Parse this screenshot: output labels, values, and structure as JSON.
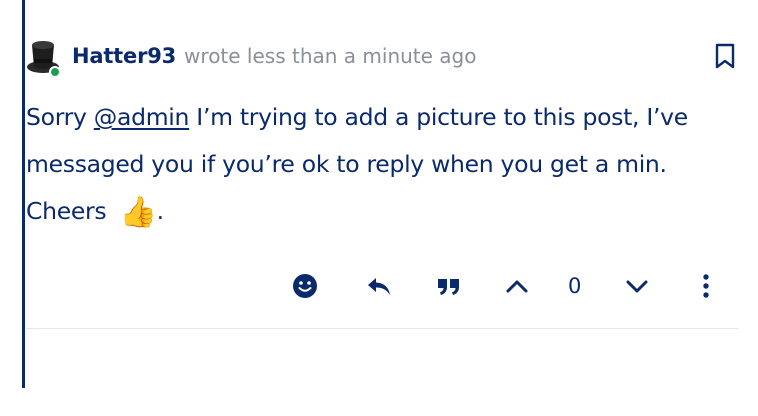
{
  "post": {
    "author": "Hatter93",
    "meta": "wrote less than a minute ago",
    "body": {
      "line1_prefix": "Sorry ",
      "mention": "@admin",
      "line1_suffix": " I’m trying to add a picture to this post, I’ve",
      "line2": "messaged you if you’re ok to reply when you get a min.",
      "line3": "Cheers ",
      "emoji": "👍",
      "trailing": "."
    }
  },
  "actions": {
    "vote_count": "0"
  },
  "colors": {
    "text": "#0b2a6b",
    "meta": "#8a8f99",
    "online": "#1f9d57",
    "divider": "#e3e6ea"
  },
  "icons": [
    "avatar-top-hat",
    "bookmark-icon",
    "emoji-icon",
    "reply-icon",
    "quote-icon",
    "upvote-icon",
    "downvote-icon",
    "more-options-icon"
  ]
}
